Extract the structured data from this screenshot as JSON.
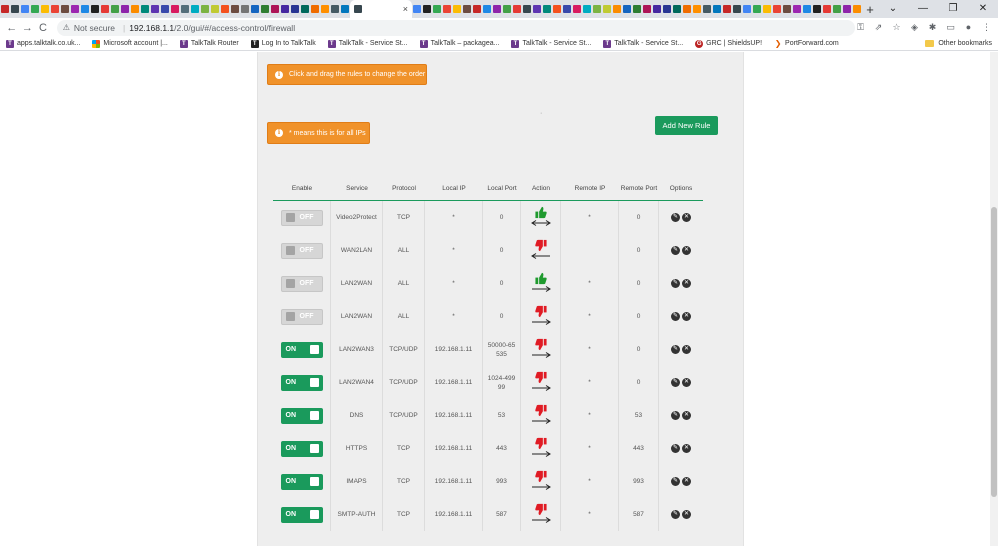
{
  "browser": {
    "tab_colors": [
      "#c62828",
      "#37474f",
      "#4285f4",
      "#34a853",
      "#fbbc04",
      "#ea4335",
      "#6d4c41",
      "#9c27b0",
      "#1e88e5",
      "#212121",
      "#e53935",
      "#43a047",
      "#8e24aa",
      "#fb8c00",
      "#00897b",
      "#5e35b1",
      "#3949ab",
      "#d81b60",
      "#546e7a",
      "#00acc1",
      "#7cb342",
      "#c0ca33",
      "#f4511e",
      "#6d4c41",
      "#757575",
      "#1565c0",
      "#2e7d32",
      "#ad1457",
      "#4527a0",
      "#283593",
      "#00695c",
      "#ef6c00",
      "#ff8f00",
      "#455a64",
      "#0277bd"
    ],
    "tab_colors_right": [
      "#4285f4",
      "#212121",
      "#34a853",
      "#ea4335",
      "#fbbc04",
      "#6d4c41",
      "#c62828",
      "#1e88e5",
      "#8e24aa",
      "#43a047",
      "#e53935",
      "#37474f",
      "#5e35b1",
      "#00897b",
      "#f4511e",
      "#3949ab",
      "#d81b60",
      "#00acc1",
      "#7cb342",
      "#c0ca33",
      "#fb8c00",
      "#1565c0",
      "#2e7d32",
      "#ad1457",
      "#4527a0",
      "#283593",
      "#00695c",
      "#ef6c00",
      "#ff8f00",
      "#455a64",
      "#0277bd",
      "#c62828",
      "#37474f",
      "#4285f4",
      "#34a853",
      "#fbbc04",
      "#ea4335",
      "#6d4c41",
      "#9c27b0",
      "#1e88e5",
      "#212121",
      "#e53935",
      "#43a047",
      "#8e24aa",
      "#fb8c00",
      "#00897b",
      "#5e35b1",
      "#3949ab",
      "#d81b60",
      "#546e7a",
      "#00acc1",
      "#7cb342",
      "#c0ca33",
      "#f4511e",
      "#757575",
      "#1565c0"
    ],
    "active_tab_close": "×",
    "new_tab": "+",
    "window_controls": [
      "⌄",
      "—",
      "❐",
      "✕"
    ],
    "nav": {
      "back": "←",
      "forward": "→",
      "reload": "C"
    },
    "security_label": "Not secure",
    "url_host": "192.168.1.1",
    "url_path": "/2.0/gui/#/access-control/firewall",
    "toolbar_icons": [
      "⚿",
      "⇗",
      "☆",
      "◈",
      "✱",
      "▭",
      "●",
      "⋮"
    ],
    "bookmarks": [
      {
        "label": "apps.talktalk.co.uk...",
        "icon": "T",
        "kind": "tt"
      },
      {
        "label": "Microsoft account |...",
        "icon": "",
        "kind": "ms"
      },
      {
        "label": "TalkTalk Router",
        "icon": "T",
        "kind": "tt"
      },
      {
        "label": "Log In to TalkTalk",
        "icon": "T",
        "kind": "dark"
      },
      {
        "label": "TalkTalk - Service St...",
        "icon": "T",
        "kind": "tt"
      },
      {
        "label": "TalkTalk – packagea...",
        "icon": "T",
        "kind": "tt"
      },
      {
        "label": "TalkTalk - Service St...",
        "icon": "T",
        "kind": "tt"
      },
      {
        "label": "TalkTalk - Service St...",
        "icon": "T",
        "kind": "tt"
      },
      {
        "label": "GRC | ShieldsUP!",
        "icon": "G",
        "kind": "grc"
      },
      {
        "label": "PortForward.com",
        "icon": "❯",
        "kind": "pf"
      }
    ],
    "other_bookmarks": "Other bookmarks"
  },
  "firewall": {
    "drag_hint": "Click and drag the rules to change the order",
    "all_ips_hint": "* means this is for all IPs",
    "info_icon": "i",
    "dot": "·",
    "add_rule_label": "Add New Rule",
    "headers": {
      "enable": "Enable",
      "service": "Service",
      "protocol": "Protocol",
      "local_ip": "Local IP",
      "local_port": "Local Port",
      "action": "Action",
      "remote_ip": "Remote IP",
      "remote_port": "Remote Port",
      "options": "Options"
    },
    "edit_icon": "✎",
    "delete_icon": "✕",
    "rules": [
      {
        "enabled": "OFF",
        "service": "Video2Protect",
        "protocol": "TCP",
        "local_ip": "*",
        "local_port": "0",
        "action": "allow",
        "direction": "both",
        "remote_ip": "*",
        "remote_port": "0"
      },
      {
        "enabled": "OFF",
        "service": "WAN2LAN",
        "protocol": "ALL",
        "local_ip": "*",
        "local_port": "0",
        "action": "block",
        "direction": "left",
        "remote_ip": "",
        "remote_port": "0"
      },
      {
        "enabled": "OFF",
        "service": "LAN2WAN",
        "protocol": "ALL",
        "local_ip": "*",
        "local_port": "0",
        "action": "allow",
        "direction": "right",
        "remote_ip": "*",
        "remote_port": "0"
      },
      {
        "enabled": "OFF",
        "service": "LAN2WAN",
        "protocol": "ALL",
        "local_ip": "*",
        "local_port": "0",
        "action": "block",
        "direction": "right",
        "remote_ip": "*",
        "remote_port": "0"
      },
      {
        "enabled": "ON",
        "service": "LAN2WAN3",
        "protocol": "TCP/UDP",
        "local_ip": "192.168.1.11",
        "local_port": "50000-65535",
        "action": "block",
        "direction": "right",
        "remote_ip": "*",
        "remote_port": "0"
      },
      {
        "enabled": "ON",
        "service": "LAN2WAN4",
        "protocol": "TCP/UDP",
        "local_ip": "192.168.1.11",
        "local_port": "1024-49999",
        "action": "block",
        "direction": "right",
        "remote_ip": "*",
        "remote_port": "0"
      },
      {
        "enabled": "ON",
        "service": "DNS",
        "protocol": "TCP/UDP",
        "local_ip": "192.168.1.11",
        "local_port": "53",
        "action": "block",
        "direction": "right",
        "remote_ip": "*",
        "remote_port": "53"
      },
      {
        "enabled": "ON",
        "service": "HTTPS",
        "protocol": "TCP",
        "local_ip": "192.168.1.11",
        "local_port": "443",
        "action": "block",
        "direction": "right",
        "remote_ip": "*",
        "remote_port": "443"
      },
      {
        "enabled": "ON",
        "service": "IMAPS",
        "protocol": "TCP",
        "local_ip": "192.168.1.11",
        "local_port": "993",
        "action": "block",
        "direction": "right",
        "remote_ip": "*",
        "remote_port": "993"
      },
      {
        "enabled": "ON",
        "service": "SMTP-AUTH",
        "protocol": "TCP",
        "local_ip": "192.168.1.11",
        "local_port": "587",
        "action": "block",
        "direction": "right",
        "remote_ip": "*",
        "remote_port": "587"
      }
    ],
    "colors": {
      "allow": "#1f9a2e",
      "block": "#e01b24",
      "accent": "#1a9a5c",
      "warning": "#f0922a"
    }
  }
}
